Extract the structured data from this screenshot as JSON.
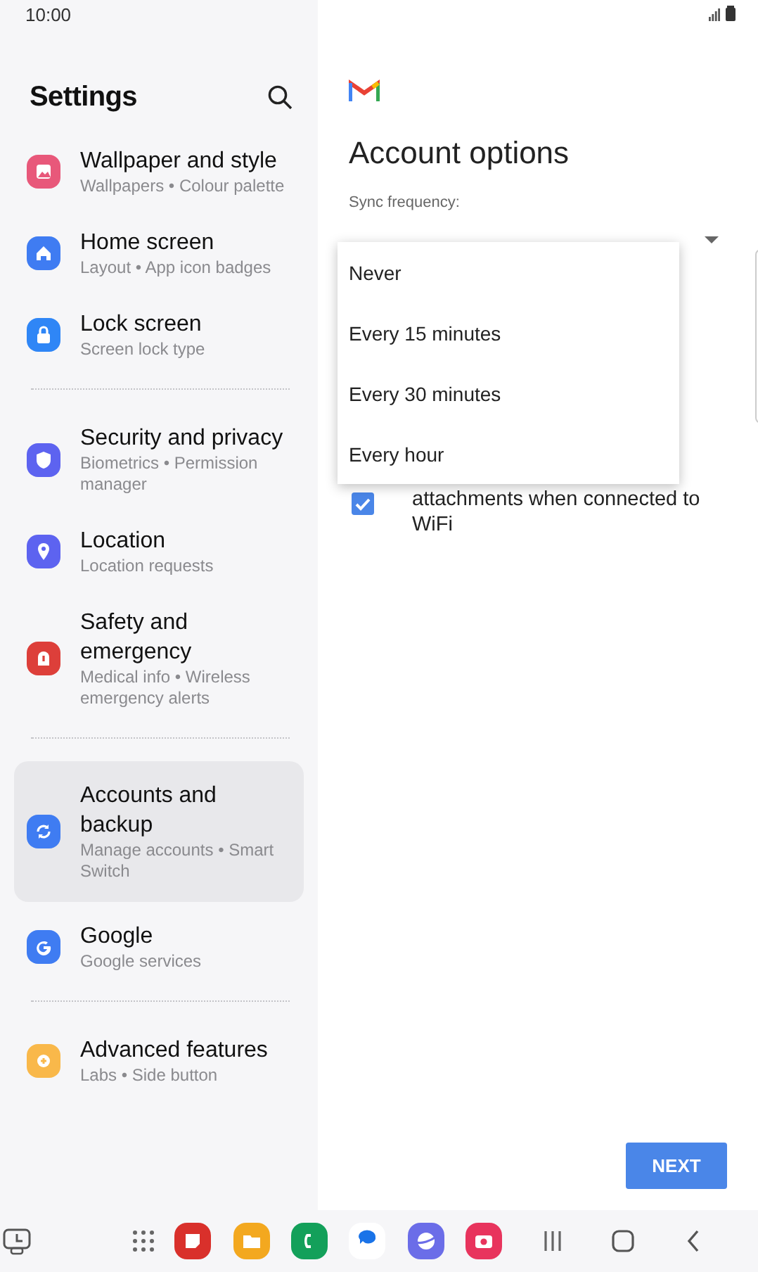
{
  "status_bar": {
    "time": "10:00"
  },
  "settings": {
    "title": "Settings",
    "groups": [
      {
        "items": [
          {
            "title": "Wallpaper and style",
            "subtitle": "Wallpapers • Colour palette",
            "selected": false
          },
          {
            "title": "Home screen",
            "subtitle": "Layout • App icon badges",
            "selected": false
          },
          {
            "title": "Lock screen",
            "subtitle": "Screen lock type",
            "selected": false
          }
        ]
      },
      {
        "items": [
          {
            "title": "Security and privacy",
            "subtitle": "Biometrics • Permission manager",
            "selected": false
          },
          {
            "title": "Location",
            "subtitle": "Location requests",
            "selected": false
          },
          {
            "title": "Safety and emergency",
            "subtitle": "Medical info • Wireless emergency alerts",
            "selected": false
          }
        ]
      },
      {
        "items": [
          {
            "title": "Accounts and backup",
            "subtitle": "Manage accounts • Smart Switch",
            "selected": true
          },
          {
            "title": "Google",
            "subtitle": "Google services",
            "selected": false
          }
        ]
      },
      {
        "items": [
          {
            "title": "Advanced features",
            "subtitle": "Labs • Side button",
            "selected": false
          }
        ]
      }
    ]
  },
  "account": {
    "title": "Account options",
    "sync_label": "Sync frequency:",
    "menu": [
      {
        "label": "Never"
      },
      {
        "label": "Every 15 minutes"
      },
      {
        "label": "Every 30 minutes"
      },
      {
        "label": "Every hour"
      }
    ],
    "checkbox": {
      "label": "attachments when connected to WiFi",
      "checked": true
    },
    "next_button": "NEXT"
  }
}
